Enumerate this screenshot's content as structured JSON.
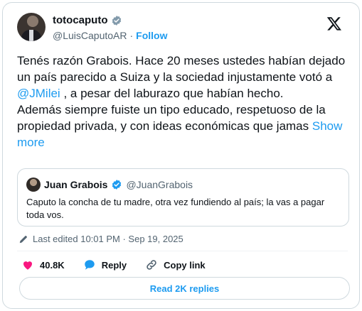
{
  "author": {
    "display_name": "totocaputo",
    "handle": "@LuisCaputoAR",
    "separator": "·",
    "follow_label": "Follow"
  },
  "tweet": {
    "paragraph1": "Tenés razón Grabois. Hace 20 meses ustedes habían dejado un país parecido a Suiza y la sociedad injustamente votó a ",
    "mention": "@JMilei",
    "paragraph1_tail": " , a pesar del laburazo que habían hecho.",
    "paragraph2": "Además siempre fuiste un tipo educado, respetuoso de la propiedad privada, y con ideas económicas que jamas ",
    "show_more": "Show more"
  },
  "quote": {
    "display_name": "Juan Grabois",
    "handle": "@JuanGrabois",
    "text": "Caputo la concha de tu madre, otra vez fundiendo al país; la vas a pagar toda vos."
  },
  "meta": {
    "edited_label": "Last edited 10:01 PM · Sep 19, 2025"
  },
  "actions": {
    "likes": "40.8K",
    "reply_label": "Reply",
    "copy_link_label": "Copy link"
  },
  "replies_button": "Read 2K replies",
  "colors": {
    "accent": "#1d9bf0",
    "like": "#f91880",
    "muted": "#536471",
    "border": "#cfd9de"
  },
  "icons": [
    "verified-badge-icon",
    "x-logo-icon",
    "pencil-icon",
    "heart-icon",
    "reply-bubble-icon",
    "link-icon"
  ]
}
